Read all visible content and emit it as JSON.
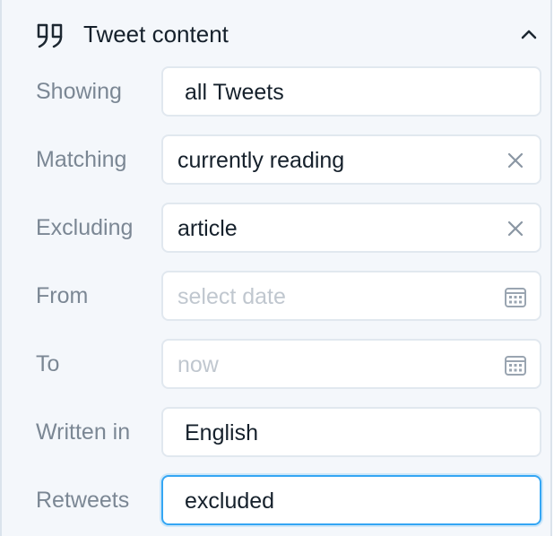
{
  "section": {
    "title": "Tweet content"
  },
  "filters": {
    "showing": {
      "label": "Showing",
      "value": "all Tweets"
    },
    "matching": {
      "label": "Matching",
      "value": "currently reading"
    },
    "excluding": {
      "label": "Excluding",
      "value": "article"
    },
    "from": {
      "label": "From",
      "placeholder": "select date"
    },
    "to": {
      "label": "To",
      "placeholder": "now"
    },
    "written_in": {
      "label": "Written in",
      "value": "English"
    },
    "retweets": {
      "label": "Retweets",
      "value": "excluded"
    }
  },
  "icons": {
    "header": "quote-icon",
    "collapse": "chevron-up-icon",
    "clear": "close-icon",
    "calendar": "calendar-icon"
  },
  "colors": {
    "panel_background": "#f4f7fb",
    "field_border": "#e1e8ef",
    "focus_border": "#34a6f4",
    "label_text": "#7b8794",
    "main_text": "#15202b",
    "placeholder_text": "#c0c7cf"
  }
}
